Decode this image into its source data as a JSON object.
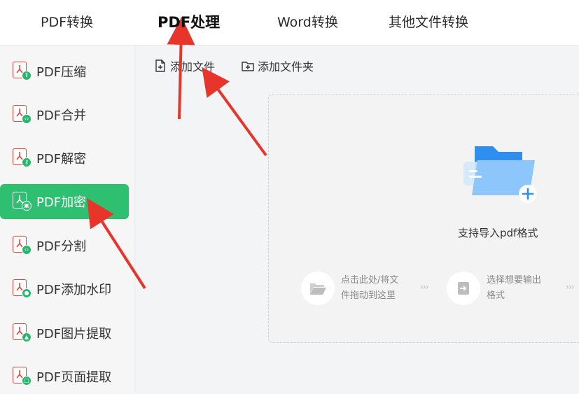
{
  "tabs": [
    {
      "label": "PDF转换",
      "active": false
    },
    {
      "label": "PDF处理",
      "active": true
    },
    {
      "label": "Word转换",
      "active": false
    },
    {
      "label": "其他文件转换",
      "active": false
    }
  ],
  "sidebar": {
    "items": [
      {
        "label": "PDF压缩",
        "icon": "compress-badge-icon",
        "active": false
      },
      {
        "label": "PDF合并",
        "icon": "merge-badge-icon",
        "active": false
      },
      {
        "label": "PDF解密",
        "icon": "key-badge-icon",
        "active": false
      },
      {
        "label": "PDF加密",
        "icon": "lock-badge-icon",
        "active": true
      },
      {
        "label": "PDF分割",
        "icon": "split-badge-icon",
        "active": false
      },
      {
        "label": "PDF添加水印",
        "icon": "drop-badge-icon",
        "active": false
      },
      {
        "label": "PDF图片提取",
        "icon": "image-badge-icon",
        "active": false
      },
      {
        "label": "PDF页面提取",
        "icon": "page-badge-icon",
        "active": false
      }
    ]
  },
  "toolbar": {
    "add_file": "添加文件",
    "add_folder": "添加文件夹"
  },
  "dropzone": {
    "title": "支持导入pdf格式",
    "step1_line1": "点击此处/将文",
    "step1_line2": "件拖动到这里",
    "step2_line1": "选择想要输出",
    "step2_line2": "格式",
    "chevrons": "›››"
  },
  "colors": {
    "accent": "#2fbf71",
    "pdf_red": "#e2463b",
    "annotation_arrow": "#e8352b",
    "folder_blue": "#5aa8f5"
  }
}
